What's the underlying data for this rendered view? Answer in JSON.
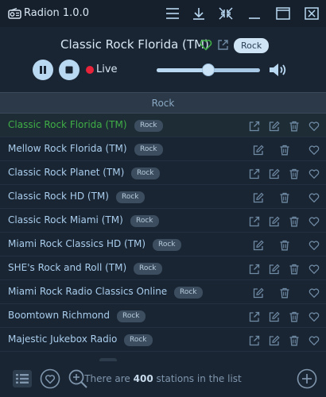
{
  "app": {
    "title": "Radion 1.0.0"
  },
  "titlebar": {
    "buttons": [
      {
        "name": "menu-button",
        "icon": "hamburger-icon"
      },
      {
        "name": "sort-button",
        "icon": "sort-download-icon"
      },
      {
        "name": "compact-view-button",
        "icon": "compress-arrows-icon"
      },
      {
        "name": "minimize-button",
        "icon": "minimize-icon"
      },
      {
        "name": "maximize-button",
        "icon": "maximize-icon"
      },
      {
        "name": "close-button",
        "icon": "close-icon"
      }
    ]
  },
  "now_playing": {
    "station": "Classic Rock Florida (TM)",
    "tag": "Rock",
    "favorited": true,
    "live_label": "Live",
    "volume_percent": 50
  },
  "list": {
    "header": "Rock",
    "rows": [
      {
        "name": "Classic Rock Florida (TM)",
        "tag": "Rock",
        "selected": true,
        "has_link": true
      },
      {
        "name": "Mellow Rock Florida (TM)",
        "tag": "Rock",
        "has_link": false
      },
      {
        "name": "Classic Rock Planet (TM)",
        "tag": "Rock",
        "has_link": true
      },
      {
        "name": "Classic Rock HD (TM)",
        "tag": "Rock",
        "has_link": false
      },
      {
        "name": "Classic Rock Miami (TM)",
        "tag": "Rock",
        "has_link": true
      },
      {
        "name": "Miami Rock Classics HD (TM)",
        "tag": "Rock",
        "has_link": false
      },
      {
        "name": "SHE's Rock and Roll (TM)",
        "tag": "Rock",
        "has_link": true
      },
      {
        "name": "Miami Rock Radio Classics Online",
        "tag": "Rock",
        "has_link": false
      },
      {
        "name": "Boomtown Richmond",
        "tag": "Rock",
        "has_link": true
      },
      {
        "name": "Majestic Jukebox Radio",
        "tag": "Rock",
        "has_link": true
      }
    ]
  },
  "footer": {
    "count_prefix": "There are ",
    "count": "400",
    "count_suffix": " stations in the list"
  },
  "colors": {
    "background": "#1a2533",
    "accent": "#b9d8f2",
    "selected_text": "#3fae45",
    "live": "#e8233a",
    "text": "#a9cdec"
  }
}
